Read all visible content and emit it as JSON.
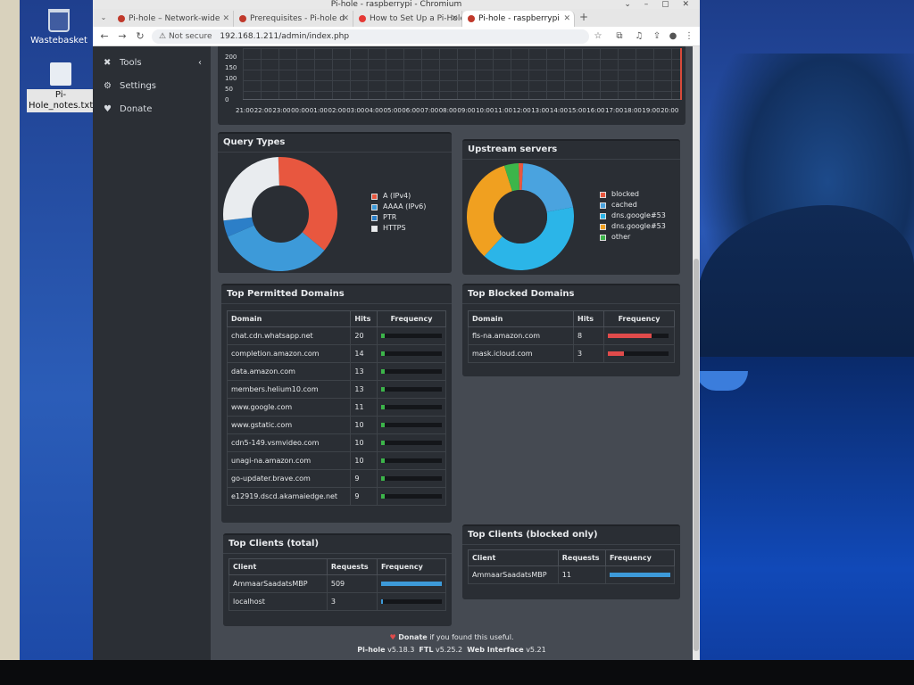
{
  "desktop": {
    "icons": [
      {
        "label": "Wastebasket"
      },
      {
        "label": "Pi-Hole_notes.txt"
      }
    ]
  },
  "browser": {
    "window_title": "Pi-hole - raspberrypi - Chromium",
    "tabs": [
      {
        "label": "Pi-hole – Network-wide",
        "favicon_color": "#c0392b"
      },
      {
        "label": "Prerequisites - Pi-hole d",
        "favicon_color": "#c0392b"
      },
      {
        "label": "How to Set Up a Pi-Hole",
        "favicon_color": "#e53935"
      },
      {
        "label": "Pi-hole - raspberrypi",
        "favicon_color": "#c0392b"
      }
    ],
    "security_label": "Not secure",
    "url": "192.168.1.211/admin/index.php"
  },
  "sidebar": {
    "items": [
      {
        "label": "Tools",
        "icon": "wrench-icon"
      },
      {
        "label": "Settings",
        "icon": "gear-icon"
      },
      {
        "label": "Donate",
        "icon": "donate-icon"
      }
    ]
  },
  "timeline": {
    "y_ticks": [
      "200",
      "150",
      "100",
      "50",
      "0"
    ],
    "x_ticks": [
      "21:00",
      "22:00",
      "23:00",
      "00:00",
      "01:00",
      "02:00",
      "03:00",
      "04:00",
      "05:00",
      "06:00",
      "07:00",
      "08:00",
      "09:00",
      "10:00",
      "11:00",
      "12:00",
      "13:00",
      "14:00",
      "15:00",
      "16:00",
      "17:00",
      "18:00",
      "19:00",
      "20:00"
    ]
  },
  "query_types": {
    "title": "Query Types",
    "legend": [
      {
        "label": "A (IPv4)",
        "color": "#e8573f"
      },
      {
        "label": "AAAA (IPv6)",
        "color": "#3d9ad9"
      },
      {
        "label": "PTR",
        "color": "#2c7fc8"
      },
      {
        "label": "HTTPS",
        "color": "#e9ecef"
      }
    ]
  },
  "upstream": {
    "title": "Upstream servers",
    "legend": [
      {
        "label": "blocked",
        "color": "#e8573f"
      },
      {
        "label": "cached",
        "color": "#4aa3df"
      },
      {
        "label": "dns.google#53",
        "color": "#2b9fe0"
      },
      {
        "label": "dns.google#53",
        "color": "#f0a020"
      },
      {
        "label": "other",
        "color": "#3cb54a"
      }
    ]
  },
  "top_permitted": {
    "title": "Top Permitted Domains",
    "headers": [
      "Domain",
      "Hits",
      "Frequency"
    ],
    "rows": [
      {
        "domain": "chat.cdn.whatsapp.net",
        "hits": "20"
      },
      {
        "domain": "completion.amazon.com",
        "hits": "14"
      },
      {
        "domain": "data.amazon.com",
        "hits": "13"
      },
      {
        "domain": "members.helium10.com",
        "hits": "13"
      },
      {
        "domain": "www.google.com",
        "hits": "11"
      },
      {
        "domain": "www.gstatic.com",
        "hits": "10"
      },
      {
        "domain": "cdn5-149.vsmvideo.com",
        "hits": "10"
      },
      {
        "domain": "unagi-na.amazon.com",
        "hits": "10"
      },
      {
        "domain": "go-updater.brave.com",
        "hits": "9"
      },
      {
        "domain": "e12919.dscd.akamaiedge.net",
        "hits": "9"
      }
    ],
    "bar_color": "#3cb54a"
  },
  "top_blocked": {
    "title": "Top Blocked Domains",
    "headers": [
      "Domain",
      "Hits",
      "Frequency"
    ],
    "rows": [
      {
        "domain": "fls-na.amazon.com",
        "hits": "8"
      },
      {
        "domain": "mask.icloud.com",
        "hits": "3"
      }
    ],
    "bar_color": "#e04b4b"
  },
  "top_clients": {
    "title": "Top Clients (total)",
    "headers": [
      "Client",
      "Requests",
      "Frequency"
    ],
    "rows": [
      {
        "client": "AmmaarSaadatsMBP",
        "requests": "509"
      },
      {
        "client": "localhost",
        "requests": "3"
      }
    ],
    "bar_color": "#3d9ad9"
  },
  "top_clients_blocked": {
    "title": "Top Clients (blocked only)",
    "headers": [
      "Client",
      "Requests",
      "Frequency"
    ],
    "rows": [
      {
        "client": "AmmaarSaadatsMBP",
        "requests": "11"
      }
    ],
    "bar_color": "#3d9ad9"
  },
  "footer": {
    "donate_link": "Donate",
    "donate_suffix": " if you found this useful.",
    "pihole_label": "Pi-hole",
    "pihole_version": "v5.18.3",
    "ftl_label": "FTL",
    "ftl_version": "v5.25.2",
    "web_label": "Web Interface",
    "web_version": "v5.21"
  }
}
